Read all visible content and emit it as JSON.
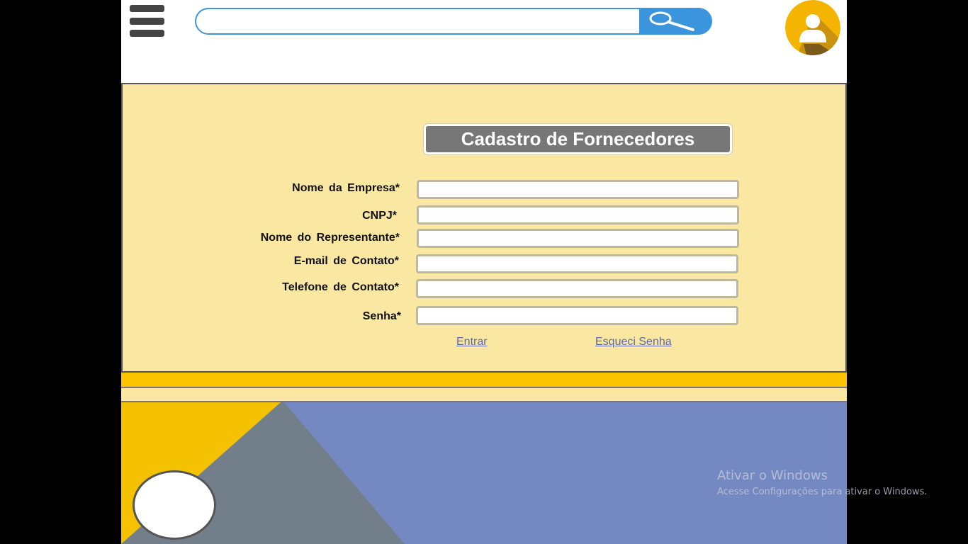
{
  "header": {
    "search": {
      "value": "",
      "placeholder": ""
    },
    "search_button_icon": "magnifier-icon",
    "menu_icon": "hamburger-icon",
    "avatar_icon": "user-avatar-icon"
  },
  "form": {
    "title": "Cadastro de Fornecedores",
    "fields": [
      {
        "label": "Nome da Empresa*",
        "value": ""
      },
      {
        "label": "CNPJ*",
        "value": ""
      },
      {
        "label": "Nome do Representante*",
        "value": ""
      },
      {
        "label": "E-mail de Contato*",
        "value": ""
      },
      {
        "label": "Telefone de Contato*",
        "value": ""
      },
      {
        "label": "Senha*",
        "value": ""
      }
    ],
    "links": {
      "enter": "Entrar",
      "forgot_password": "Esqueci Senha"
    }
  },
  "colors": {
    "page_bg": "#000000",
    "header_bg": "#ffffff",
    "search_accent": "#3a95dd",
    "panel_bg": "#f9e7a2",
    "title_bg": "#777777",
    "band_yellow": "#fcc400",
    "footer_yellow": "#f4c200",
    "footer_gray": "#727f8b",
    "footer_blue": "#7489c2",
    "link": "#5d6aa8",
    "avatar_bg": "#f4b400"
  },
  "watermark": {
    "title": "Ativar o Windows",
    "subtitle": "Acesse Configurações para ativar o Windows."
  }
}
